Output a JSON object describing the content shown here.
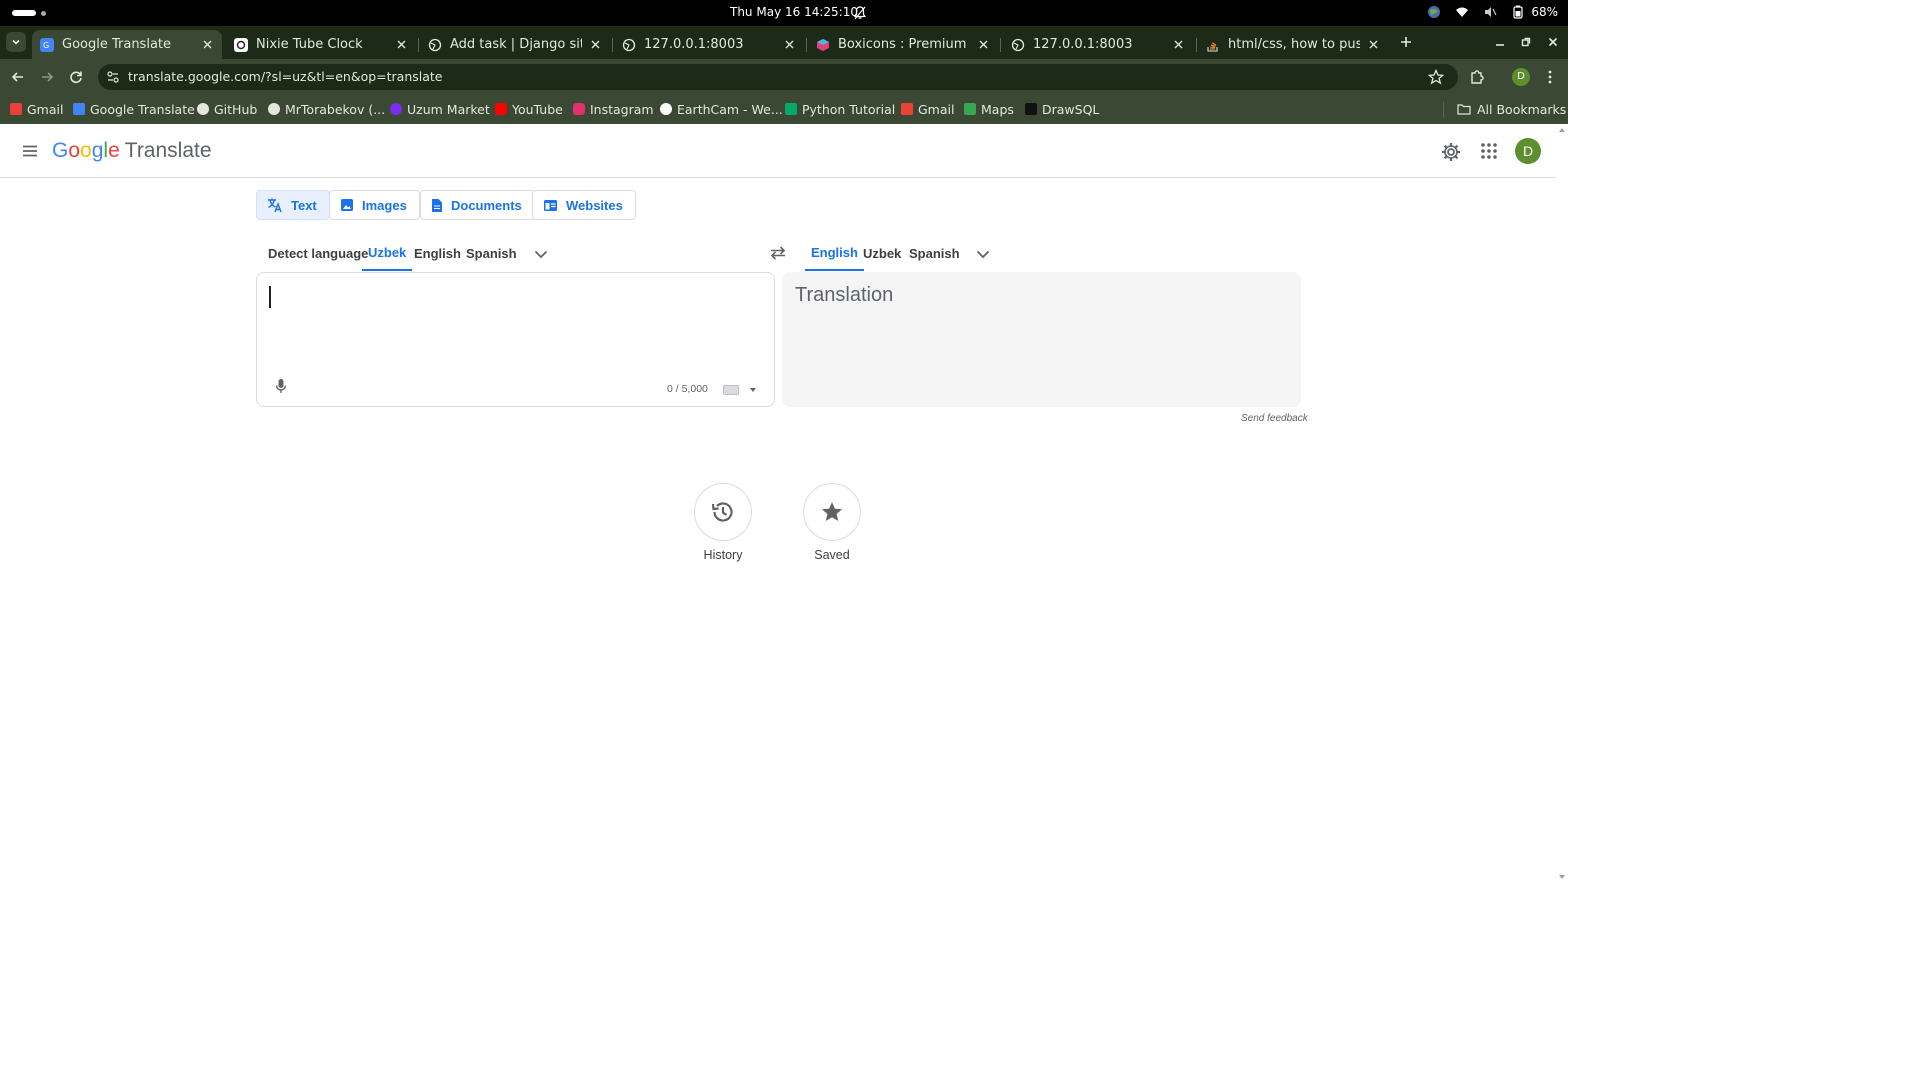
{
  "os": {
    "clock": "Thu May 16  14:25:10",
    "battery": "68%"
  },
  "tabs": [
    {
      "title": "Google Translate",
      "active": true
    },
    {
      "title": "Nixie Tube Clock",
      "active": false
    },
    {
      "title": "Add task | Django site ad",
      "active": false
    },
    {
      "title": "127.0.0.1:8003",
      "active": false
    },
    {
      "title": "Boxicons : Premium web",
      "active": false
    },
    {
      "title": "127.0.0.1:8003",
      "active": false
    },
    {
      "title": "html/css, how to push an",
      "active": false
    }
  ],
  "toolbar": {
    "url": "translate.google.com/?sl=uz&tl=en&op=translate",
    "profile_initial": "D"
  },
  "bookmarks": {
    "items": [
      "Gmail",
      "Google Translate",
      "GitHub",
      "MrTorabekov (...",
      "Uzum Market",
      "YouTube",
      "Instagram",
      "EarthCam - We...",
      "Python Tutorial",
      "Gmail",
      "Maps",
      "DrawSQL"
    ],
    "all_bookmarks": "All Bookmarks"
  },
  "header": {
    "logo_letters": [
      "G",
      "o",
      "o",
      "g",
      "l",
      "e"
    ],
    "product": "Translate",
    "account_initial": "D"
  },
  "modes": [
    "Text",
    "Images",
    "Documents",
    "Websites"
  ],
  "source_langs": [
    "Detect language",
    "Uzbek",
    "English",
    "Spanish"
  ],
  "target_langs": [
    "English",
    "Uzbek",
    "Spanish"
  ],
  "source": {
    "char_count": "0 / 5,000"
  },
  "target": {
    "placeholder": "Translation"
  },
  "feedback": "Send feedback",
  "actions": [
    "History",
    "Saved"
  ],
  "colors": {
    "accent": "#1a73e8",
    "browser_dark": "#1e2a18",
    "browser_toolbar": "#3b4934",
    "avatar": "#5e8f2e"
  }
}
